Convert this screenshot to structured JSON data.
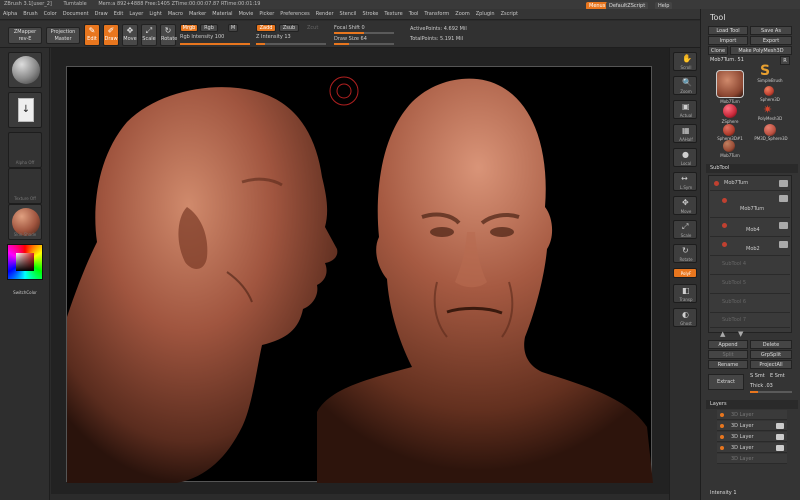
{
  "titlebar": {
    "items": [
      "ZBrush 3.1[user_2]",
      "Turntable",
      "Mem:a 892+4888 Free:1405 ZTime:00:00:07.87 RTime:00:01:19"
    ]
  },
  "menubar": {
    "items": [
      "Alpha",
      "Brush",
      "Color",
      "Document",
      "Draw",
      "Edit",
      "Layer",
      "Light",
      "Macro",
      "Marker",
      "Material",
      "Movie",
      "Picker",
      "Preferences",
      "Render",
      "Stencil",
      "Stroke",
      "Texture",
      "Tool",
      "Transform",
      "Zoom",
      "Zplugin",
      "Zscript"
    ],
    "right": {
      "menus": "Menus",
      "script": "DefaultZScript",
      "help": "Help"
    }
  },
  "toolbar": {
    "zmapper": "ZMapper rev-E",
    "projection": "Projection Master",
    "edit": "Edit",
    "draw": "Draw",
    "move": "Move",
    "scale": "Scale",
    "rotate": "Rotate",
    "mrgb": "Mrgb",
    "rgb": "Rgb",
    "m": "M",
    "rgb_intensity_label": "Rgb Intensity",
    "rgb_intensity": "100",
    "zadd": "Zadd",
    "zsub": "Zsub",
    "zcut": "Zcut",
    "z_intensity_label": "Z Intensity",
    "z_intensity": "13",
    "focal_shift_label": "Focal Shift",
    "focal_shift": "0",
    "draw_size_label": "Draw Size",
    "draw_size": "64",
    "active_points_label": "ActivePoints:",
    "active_points": "4.692 Mil",
    "total_points_label": "TotalPoints:",
    "total_points": "5.191 Mil"
  },
  "leftshelf": {
    "labels": [
      "",
      "",
      "Alpha Off",
      "Texture Off",
      "Skin-Shade"
    ],
    "switch_color": "SwitchColor"
  },
  "rightshelf": {
    "buttons": [
      "Scroll",
      "Zoom",
      "Actual",
      "AAHalf",
      "Local",
      "L.Sym",
      "Move",
      "Scale",
      "Rotate",
      "PolyF",
      "Transp",
      "Ghost"
    ]
  },
  "tray": {
    "title": "Tool",
    "load_tool": "Load Tool",
    "save_as": "Save As",
    "import": "Import",
    "export": "Export",
    "clone": "Clone",
    "make_polymesh": "Make PolyMesh3D",
    "current_tool": "Mob7Turn. 51",
    "current_count": "R",
    "tools": [
      {
        "name": "Mob7Turn",
        "color": "#b85a3e"
      },
      {
        "name": "SimpleBrush",
        "color": "#d4aa55"
      },
      {
        "name": "Sphere3D",
        "color": "#c04030"
      },
      {
        "name": "ZSphere",
        "color": "#c8283a"
      },
      {
        "name": "PolyMesh3D",
        "color": "#d8442c"
      },
      {
        "name": "Sphere3D#1",
        "color": "#b03c2c"
      },
      {
        "name": "PM3D_Sphere3D",
        "color": "#bb5040"
      },
      {
        "name": "Mob7Turn",
        "color": "#9a4c36"
      }
    ],
    "subtool_header": "SubTool",
    "subtools": [
      "Mob7Turn",
      "Mob7Turn",
      "Mob4",
      "Mob2",
      "SubTool 4",
      "SubTool 5",
      "SubTool 6",
      "SubTool 7"
    ],
    "append": "Append",
    "delete": "Delete",
    "split": "Split",
    "grp_split": "GrpSplit",
    "rename": "Rename",
    "project_all": "ProjectAll",
    "extract": "Extract",
    "s_smt": "S Smt",
    "e_smt": "E Smt",
    "thick": "Thick",
    "thick_val": ".03",
    "layers_header": "Layers",
    "layers": [
      "3D Layer",
      "3D Layer",
      "3D Layer",
      "3D Layer",
      "3D Layer"
    ],
    "intensity_label": "Intensity",
    "intensity": "1"
  },
  "colors": {
    "accent": "#e8761e",
    "skin": "#a0553f",
    "panel": "#343434",
    "background": "#000000"
  }
}
